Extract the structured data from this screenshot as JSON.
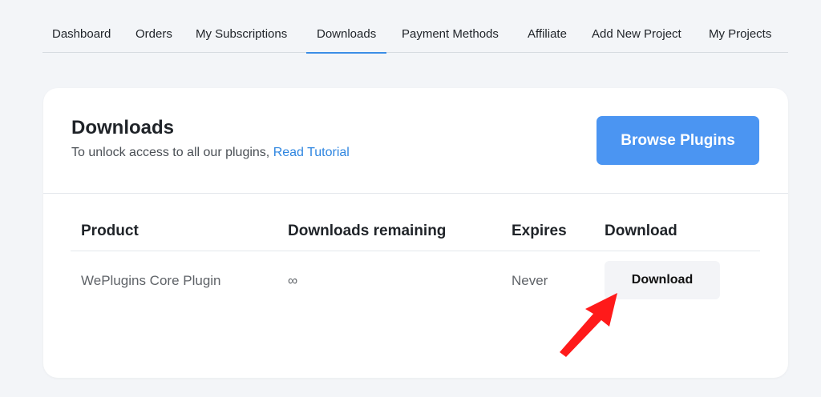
{
  "nav": {
    "tabs": [
      {
        "label": "Dashboard"
      },
      {
        "label": "Orders"
      },
      {
        "label": "My Subscriptions"
      },
      {
        "label": "Downloads",
        "active": true
      },
      {
        "label": "Payment Methods"
      },
      {
        "label": "Affiliate"
      },
      {
        "label": "Add New Project"
      },
      {
        "label": "My Projects"
      }
    ]
  },
  "header": {
    "title": "Downloads",
    "subtitle_text": "To unlock access to all our plugins, ",
    "subtitle_link": "Read Tutorial",
    "browse_button": "Browse Plugins"
  },
  "table": {
    "columns": [
      "Product",
      "Downloads remaining",
      "Expires",
      "Download"
    ],
    "rows": [
      {
        "product": "WePlugins Core Plugin",
        "remaining": "∞",
        "expires": "Never",
        "download_label": "Download"
      }
    ]
  },
  "colors": {
    "accent": "#4b95f2",
    "link": "#2f86e0",
    "annotation_arrow": "#ff1a1a"
  },
  "icons": {
    "annotation": "red-pointer-arrow"
  }
}
